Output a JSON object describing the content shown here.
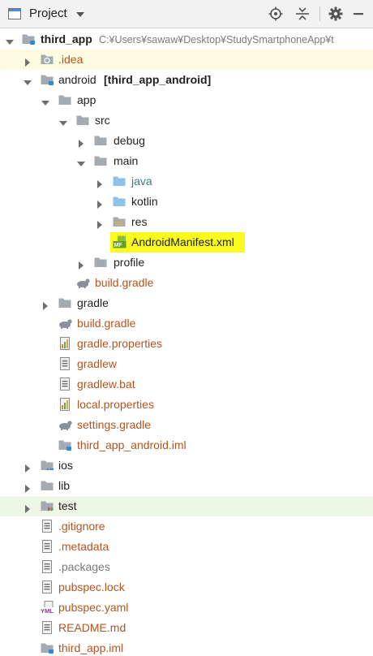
{
  "header": {
    "title": "Project",
    "icons": {
      "view": "project-view-icon",
      "dropdown": "chevron-down-icon",
      "locate": "crosshair-icon",
      "collapse": "collapse-all-icon",
      "settings": "gear-icon",
      "hide": "minimize-icon"
    }
  },
  "tree": {
    "root_label": "third_app",
    "root_path": "C:¥Users¥sawaw¥Desktop¥StudySmartphoneApp¥t",
    "idea": ".idea",
    "android_name": "android",
    "android_module": "[third_app_android]",
    "app": "app",
    "src": "src",
    "debug": "debug",
    "main": "main",
    "java": "java",
    "kotlin": "kotlin",
    "res": "res",
    "manifest": "AndroidManifest.xml",
    "profile": "profile",
    "app_build_gradle": "build.gradle",
    "gradle_dir": "gradle",
    "build_gradle": "build.gradle",
    "gradle_properties": "gradle.properties",
    "gradlew": "gradlew",
    "gradlew_bat": "gradlew.bat",
    "local_properties": "local.properties",
    "settings_gradle": "settings.gradle",
    "android_iml": "third_app_android.iml",
    "ios": "ios",
    "lib": "lib",
    "test": "test",
    "gitignore": ".gitignore",
    "metadata": ".metadata",
    "packages": ".packages",
    "pubspec_lock": "pubspec.lock",
    "pubspec_yaml": "pubspec.yaml",
    "readme": "README.md",
    "app_iml": "third_app.iml"
  },
  "colors": {
    "header_bg": "#f2f2f2",
    "manifest_highlight": "#fafa1e",
    "idea_row_bg": "#fdfbe0",
    "test_row_bg": "#eef6e6",
    "gradle_file_text": "#b5531d",
    "resource_text": "#3a7c82"
  }
}
